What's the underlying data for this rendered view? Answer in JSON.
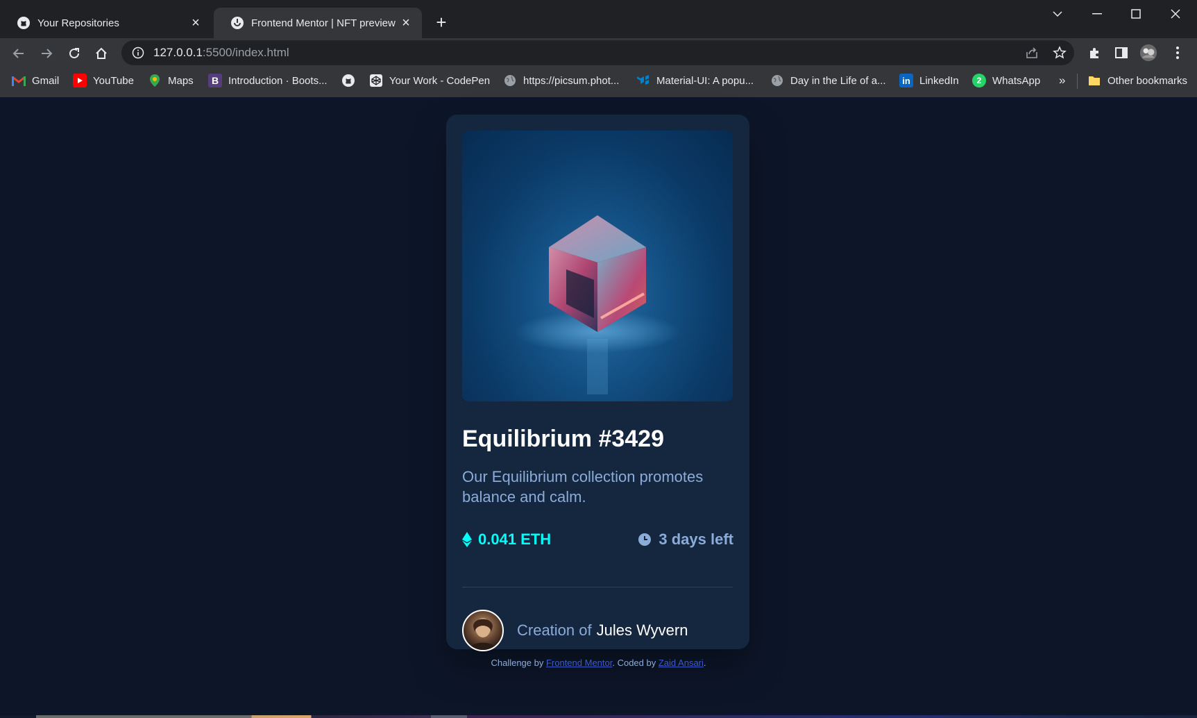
{
  "browser": {
    "tabs": [
      {
        "title": "Your Repositories",
        "icon": "github-icon"
      },
      {
        "title": "Frontend Mentor | NFT preview c",
        "icon": "frontend-mentor-icon"
      }
    ],
    "url_host": "127.0.0.1",
    "url_rest": ":5500/index.html",
    "bookmarks": [
      {
        "label": "Gmail",
        "icon": "gmail-icon"
      },
      {
        "label": "YouTube",
        "icon": "youtube-icon"
      },
      {
        "label": "Maps",
        "icon": "maps-icon"
      },
      {
        "label": "Introduction · Boots...",
        "icon": "bootstrap-icon"
      },
      {
        "label": "",
        "icon": "github-icon"
      },
      {
        "label": "Your Work - CodePen",
        "icon": "codepen-icon"
      },
      {
        "label": "https://picsum.phot...",
        "icon": "globe-icon"
      },
      {
        "label": "Material-UI: A popu...",
        "icon": "material-ui-icon"
      },
      {
        "label": "Day in the Life of a...",
        "icon": "globe-icon"
      },
      {
        "label": "LinkedIn",
        "icon": "linkedin-icon"
      },
      {
        "label": "WhatsApp",
        "icon": "whatsapp-icon"
      }
    ],
    "bookmarks_overflow": "»",
    "other_bookmarks": "Other bookmarks"
  },
  "card": {
    "title": "Equilibrium #3429",
    "description": "Our Equilibrium collection promotes balance and calm.",
    "price": "0.041 ETH",
    "time_left": "3 days left",
    "creator_prefix": "Creation of",
    "creator_name": "Jules Wyvern"
  },
  "footer": {
    "prefix": "Challenge by ",
    "link1": "Frontend Mentor",
    "middle": ". Coded by ",
    "link2": "Zaid Ansari",
    "suffix": "."
  },
  "colors": {
    "page_bg": "#0d1629",
    "card_bg": "#15263f",
    "cyan": "#00fff8",
    "soft_blue": "#8bacd9",
    "white": "#ffffff"
  }
}
